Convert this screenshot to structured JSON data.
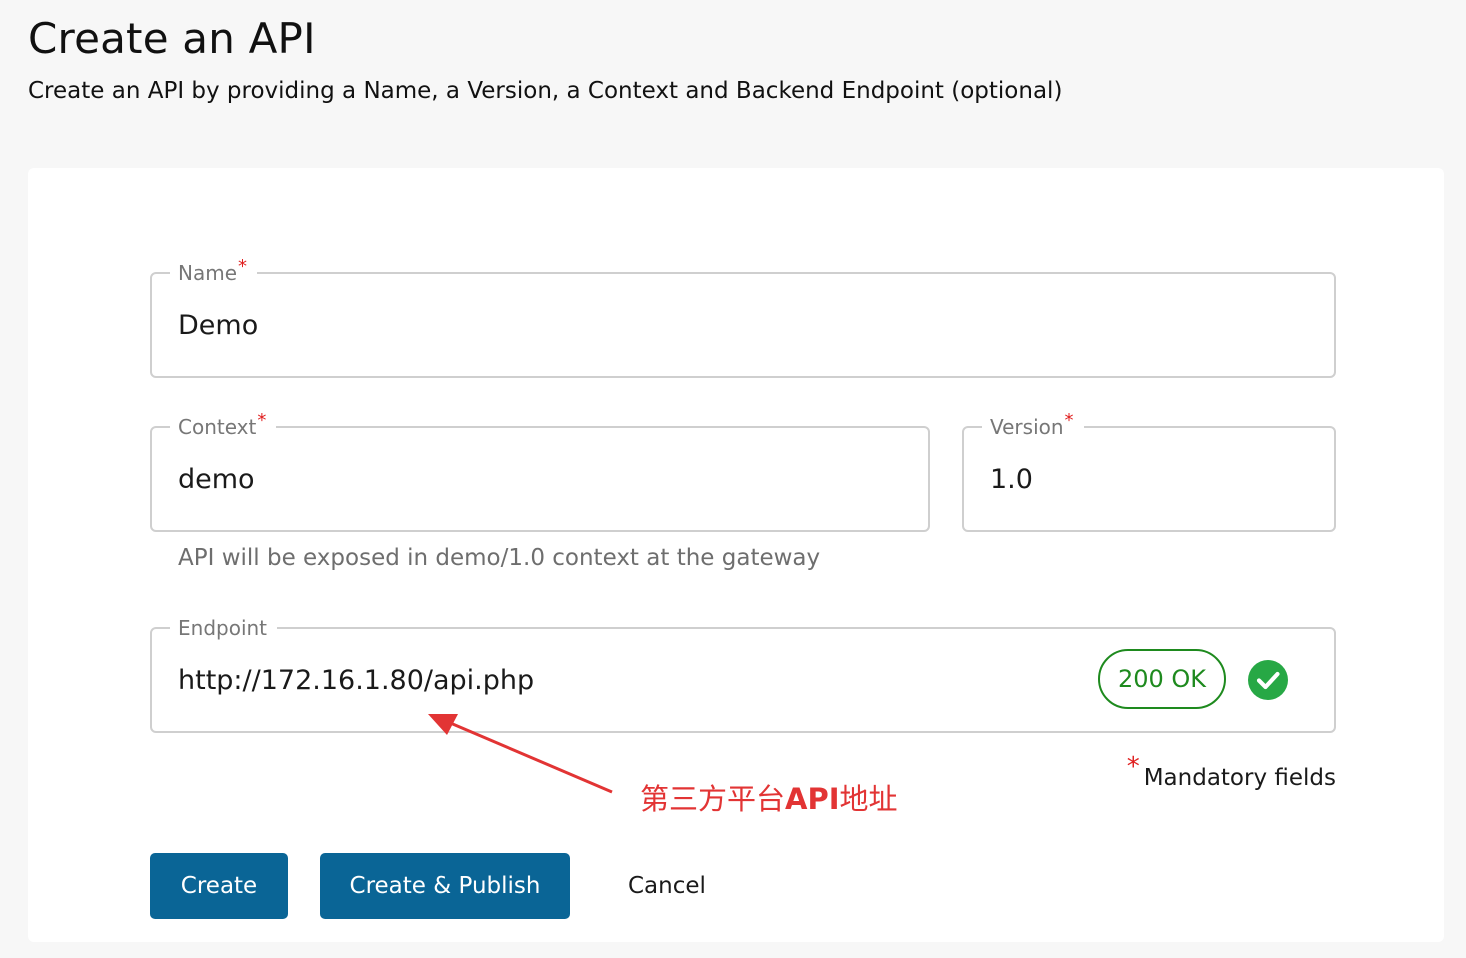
{
  "header": {
    "title": "Create an API",
    "subtitle": "Create an API by providing a Name, a Version, a Context and Backend Endpoint (optional)"
  },
  "form": {
    "name": {
      "label": "Name",
      "required_mark": "*",
      "value": "Demo"
    },
    "context": {
      "label": "Context",
      "required_mark": "*",
      "value": "demo"
    },
    "version": {
      "label": "Version",
      "required_mark": "*",
      "value": "1.0"
    },
    "context_helper": "API will be exposed in demo/1.0 context at the gateway",
    "endpoint": {
      "label": "Endpoint",
      "value": "http://172.16.1.80/api.php",
      "status_text": "200 OK",
      "status_icon": "check-circle-icon"
    },
    "mandatory": {
      "mark": "*",
      "text": "Mandatory fields"
    }
  },
  "annotation": {
    "text_part1": "第三方平台",
    "text_bold": "API",
    "text_part2": "地址"
  },
  "actions": {
    "create_label": "Create",
    "create_publish_label": "Create & Publish",
    "cancel_label": "Cancel"
  },
  "colors": {
    "primary_button": "#0a6596",
    "success": "#1e8a1e",
    "required": "#e02020",
    "annotation": "#e23434"
  }
}
